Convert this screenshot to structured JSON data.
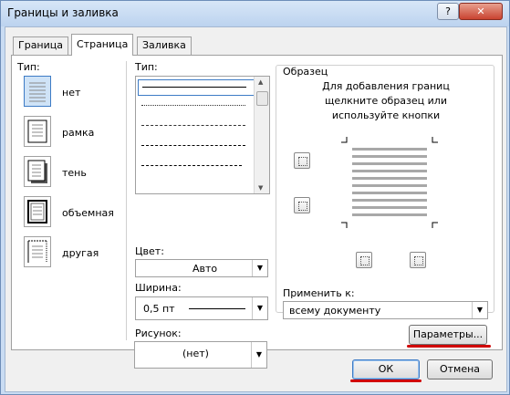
{
  "window": {
    "title": "Границы и заливка",
    "help": "?",
    "close": "✕"
  },
  "tabs": [
    "Граница",
    "Страница",
    "Заливка"
  ],
  "setting": {
    "label": "Тип:",
    "items": [
      "нет",
      "рамка",
      "тень",
      "объемная",
      "другая"
    ]
  },
  "style": {
    "label": "Тип:"
  },
  "color": {
    "label": "Цвет:",
    "value": "Авто"
  },
  "width": {
    "label": "Ширина:",
    "value": "0,5 пт"
  },
  "art": {
    "label": "Рисунок:",
    "value": "(нет)"
  },
  "preview": {
    "label": "Образец",
    "hint": [
      "Для добавления границ",
      "щелкните образец или",
      "используйте кнопки"
    ]
  },
  "apply": {
    "label": "Применить к:",
    "value": "всему документу"
  },
  "buttons": {
    "options": "Параметры...",
    "ok": "ОК",
    "cancel": "Отмена"
  }
}
